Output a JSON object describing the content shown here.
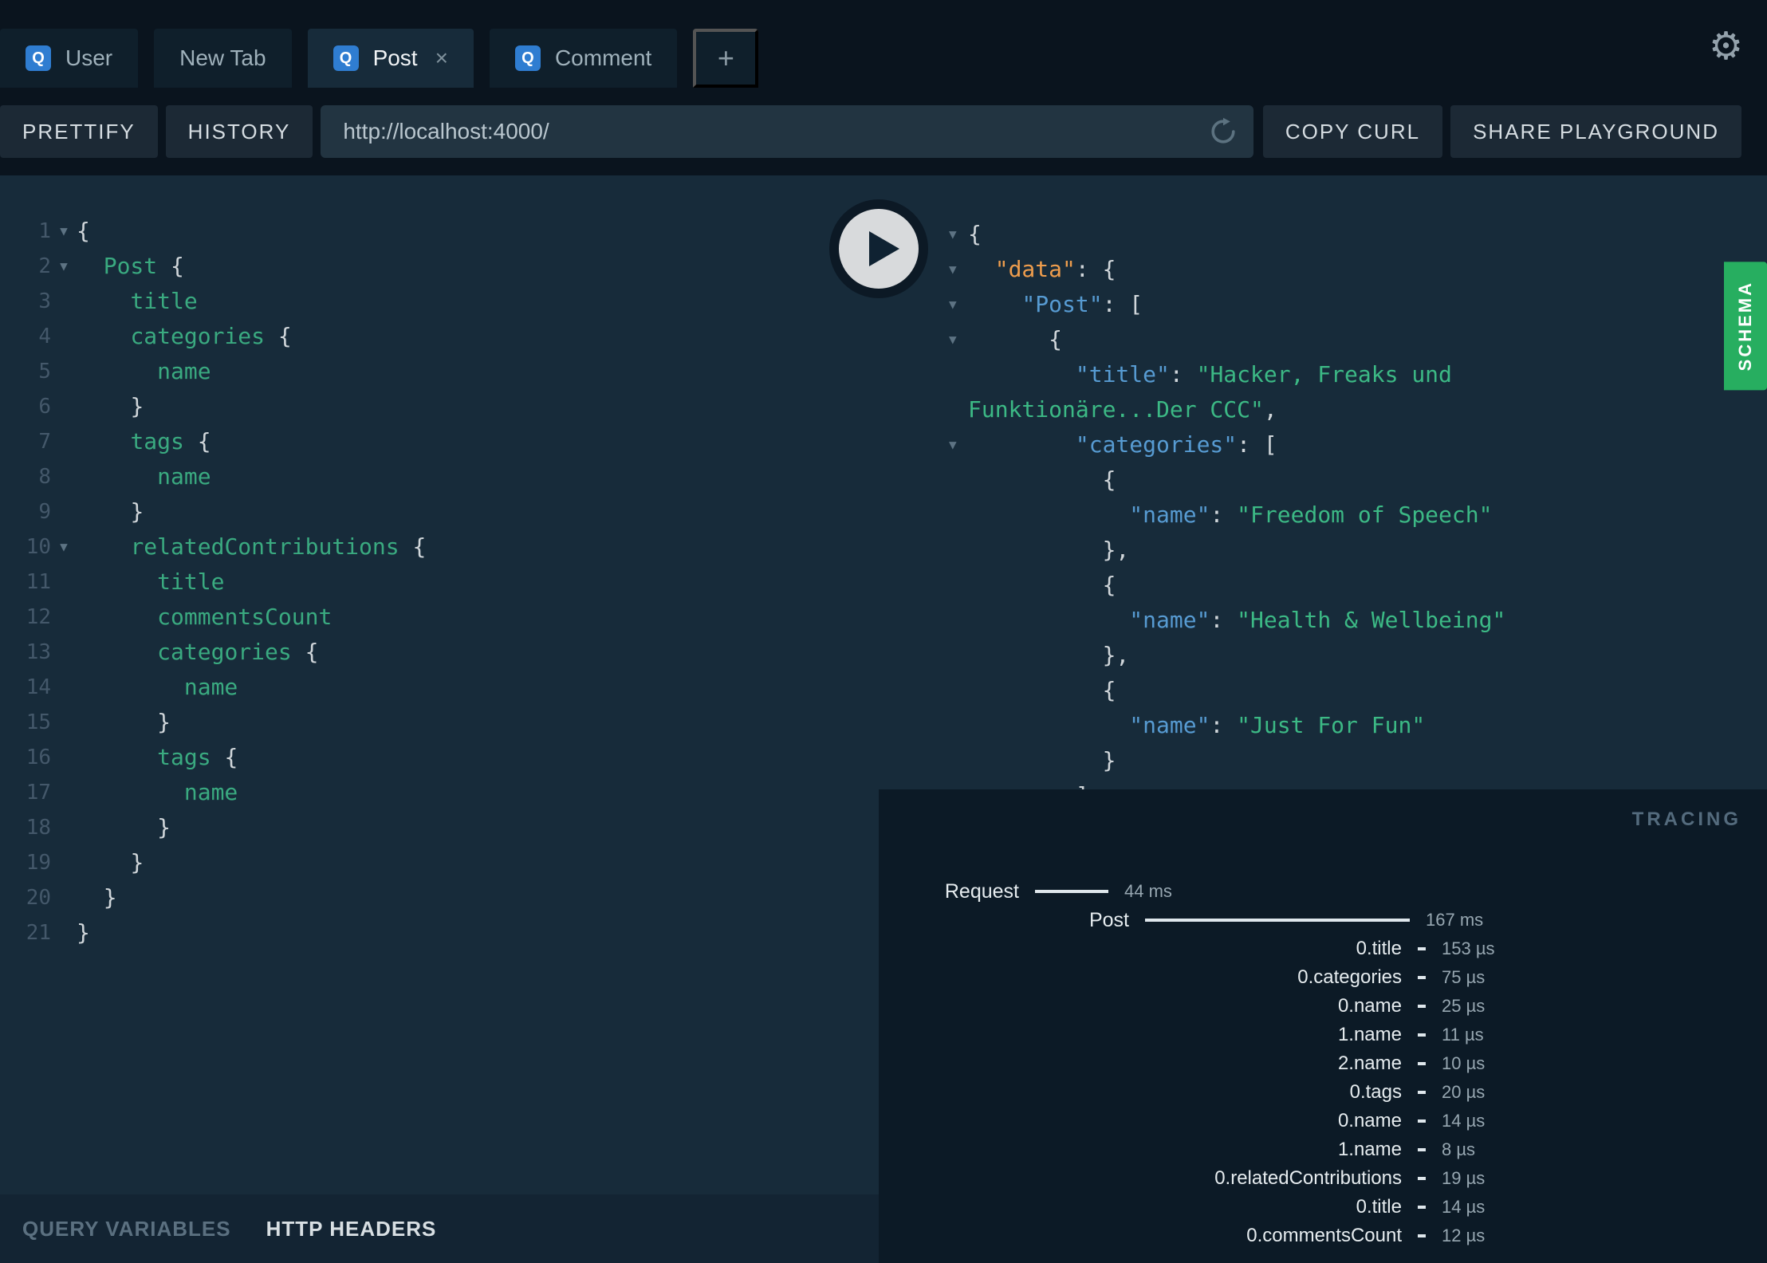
{
  "colors": {
    "schema_green": "#27ae60",
    "badge_blue": "#2f7dd1",
    "field_green": "#3aaa80",
    "key_blue": "#579bd2",
    "data_orange": "#ee9d4d",
    "string_green": "#3cb985"
  },
  "icons": {
    "settings": "⚙",
    "close": "×",
    "add": "+",
    "fold": "▼",
    "play": "play-triangle",
    "reload": "circular-arrow"
  },
  "tab_bar": {
    "tabs": [
      {
        "label": "User",
        "badge": "Q",
        "active": false,
        "closable": false
      },
      {
        "label": "New Tab",
        "badge": "",
        "active": false,
        "closable": false
      },
      {
        "label": "Post",
        "badge": "Q",
        "active": true,
        "closable": true
      },
      {
        "label": "Comment",
        "badge": "Q",
        "active": false,
        "closable": false
      }
    ]
  },
  "toolbar": {
    "prettify": "PRETTIFY",
    "history": "HISTORY",
    "url": "http://localhost:4000/",
    "copy_curl": "COPY CURL",
    "share": "SHARE PLAYGROUND"
  },
  "query_editor": {
    "lines": [
      {
        "n": 1,
        "indent": 0,
        "fold": true,
        "tokens": [
          [
            "{",
            "p"
          ]
        ]
      },
      {
        "n": 2,
        "indent": 1,
        "fold": true,
        "tokens": [
          [
            "Post ",
            "f"
          ],
          [
            "{",
            "p"
          ]
        ]
      },
      {
        "n": 3,
        "indent": 2,
        "fold": false,
        "tokens": [
          [
            "title",
            "f"
          ]
        ]
      },
      {
        "n": 4,
        "indent": 2,
        "fold": false,
        "tokens": [
          [
            "categories ",
            "f"
          ],
          [
            "{",
            "p"
          ]
        ]
      },
      {
        "n": 5,
        "indent": 3,
        "fold": false,
        "tokens": [
          [
            "name",
            "f"
          ]
        ]
      },
      {
        "n": 6,
        "indent": 2,
        "fold": false,
        "tokens": [
          [
            "}",
            "p"
          ]
        ]
      },
      {
        "n": 7,
        "indent": 2,
        "fold": false,
        "tokens": [
          [
            "tags ",
            "f"
          ],
          [
            "{",
            "p"
          ]
        ]
      },
      {
        "n": 8,
        "indent": 3,
        "fold": false,
        "tokens": [
          [
            "name",
            "f"
          ]
        ]
      },
      {
        "n": 9,
        "indent": 2,
        "fold": false,
        "tokens": [
          [
            "}",
            "p"
          ]
        ]
      },
      {
        "n": 10,
        "indent": 2,
        "fold": true,
        "tokens": [
          [
            "relatedContributions ",
            "f"
          ],
          [
            "{",
            "p"
          ]
        ]
      },
      {
        "n": 11,
        "indent": 3,
        "fold": false,
        "tokens": [
          [
            "title",
            "f"
          ]
        ]
      },
      {
        "n": 12,
        "indent": 3,
        "fold": false,
        "tokens": [
          [
            "commentsCount",
            "f"
          ]
        ]
      },
      {
        "n": 13,
        "indent": 3,
        "fold": false,
        "tokens": [
          [
            "categories ",
            "f"
          ],
          [
            "{",
            "p"
          ]
        ]
      },
      {
        "n": 14,
        "indent": 4,
        "fold": false,
        "tokens": [
          [
            "name",
            "f"
          ]
        ]
      },
      {
        "n": 15,
        "indent": 3,
        "fold": false,
        "tokens": [
          [
            "}",
            "p"
          ]
        ]
      },
      {
        "n": 16,
        "indent": 3,
        "fold": false,
        "tokens": [
          [
            "tags ",
            "f"
          ],
          [
            "{",
            "p"
          ]
        ]
      },
      {
        "n": 17,
        "indent": 4,
        "fold": false,
        "tokens": [
          [
            "name",
            "f"
          ]
        ]
      },
      {
        "n": 18,
        "indent": 3,
        "fold": false,
        "tokens": [
          [
            "}",
            "p"
          ]
        ]
      },
      {
        "n": 19,
        "indent": 2,
        "fold": false,
        "tokens": [
          [
            "}",
            "p"
          ]
        ]
      },
      {
        "n": 20,
        "indent": 1,
        "fold": false,
        "tokens": [
          [
            "}",
            "p"
          ]
        ]
      },
      {
        "n": 21,
        "indent": 0,
        "fold": false,
        "tokens": [
          [
            "}",
            "p"
          ]
        ]
      }
    ]
  },
  "response": {
    "lines": [
      {
        "indent": 0,
        "fold": true,
        "tokens": [
          [
            "{",
            "p"
          ]
        ]
      },
      {
        "indent": 1,
        "fold": true,
        "tokens": [
          [
            "\"data\"",
            "d"
          ],
          [
            ": {",
            "p"
          ]
        ]
      },
      {
        "indent": 2,
        "fold": true,
        "tokens": [
          [
            "\"Post\"",
            "k"
          ],
          [
            ": [",
            "p"
          ]
        ]
      },
      {
        "indent": 3,
        "fold": true,
        "tokens": [
          [
            "{",
            "p"
          ]
        ]
      },
      {
        "indent": 4,
        "fold": false,
        "tokens": [
          [
            "\"title\"",
            "k"
          ],
          [
            ": ",
            "p"
          ],
          [
            "\"Hacker, Freaks und",
            "s"
          ]
        ]
      },
      {
        "indent": 0,
        "fold": false,
        "tokens": [
          [
            "Funktionäre...Der CCC\"",
            "s"
          ],
          [
            ",",
            "p"
          ]
        ]
      },
      {
        "indent": 4,
        "fold": true,
        "tokens": [
          [
            "\"categories\"",
            "k"
          ],
          [
            ": [",
            "p"
          ]
        ]
      },
      {
        "indent": 5,
        "fold": false,
        "tokens": [
          [
            "{",
            "p"
          ]
        ]
      },
      {
        "indent": 6,
        "fold": false,
        "tokens": [
          [
            "\"name\"",
            "k"
          ],
          [
            ": ",
            "p"
          ],
          [
            "\"Freedom of Speech\"",
            "s"
          ]
        ]
      },
      {
        "indent": 5,
        "fold": false,
        "tokens": [
          [
            "},",
            "p"
          ]
        ]
      },
      {
        "indent": 5,
        "fold": false,
        "tokens": [
          [
            "{",
            "p"
          ]
        ]
      },
      {
        "indent": 6,
        "fold": false,
        "tokens": [
          [
            "\"name\"",
            "k"
          ],
          [
            ": ",
            "p"
          ],
          [
            "\"Health & Wellbeing\"",
            "s"
          ]
        ]
      },
      {
        "indent": 5,
        "fold": false,
        "tokens": [
          [
            "},",
            "p"
          ]
        ]
      },
      {
        "indent": 5,
        "fold": false,
        "tokens": [
          [
            "{",
            "p"
          ]
        ]
      },
      {
        "indent": 6,
        "fold": false,
        "tokens": [
          [
            "\"name\"",
            "k"
          ],
          [
            ": ",
            "p"
          ],
          [
            "\"Just For Fun\"",
            "s"
          ]
        ]
      },
      {
        "indent": 5,
        "fold": false,
        "tokens": [
          [
            "}",
            "p"
          ]
        ]
      },
      {
        "indent": 4,
        "fold": false,
        "tokens": [
          [
            "]",
            "p"
          ]
        ]
      }
    ]
  },
  "schema_tab": {
    "label": "SCHEMA"
  },
  "tracing": {
    "title": "TRACING",
    "rows": [
      {
        "label": "Request",
        "time": "44 ms",
        "kind": "root",
        "bar_start": 98,
        "bar_len": 46
      },
      {
        "label": "Post",
        "time": "167 ms",
        "kind": "root",
        "bar_start": 167,
        "bar_len": 166
      },
      {
        "label": "0.title",
        "time": "153 µs",
        "kind": "field",
        "bar_start": 338,
        "bar_len": 5
      },
      {
        "label": "0.categories",
        "time": "75 µs",
        "kind": "field",
        "bar_start": 338,
        "bar_len": 5
      },
      {
        "label": "0.name",
        "time": "25 µs",
        "kind": "field",
        "bar_start": 338,
        "bar_len": 5
      },
      {
        "label": "1.name",
        "time": "11 µs",
        "kind": "field",
        "bar_start": 338,
        "bar_len": 5
      },
      {
        "label": "2.name",
        "time": "10 µs",
        "kind": "field",
        "bar_start": 338,
        "bar_len": 5
      },
      {
        "label": "0.tags",
        "time": "20 µs",
        "kind": "field",
        "bar_start": 338,
        "bar_len": 5
      },
      {
        "label": "0.name",
        "time": "14 µs",
        "kind": "field",
        "bar_start": 338,
        "bar_len": 5
      },
      {
        "label": "1.name",
        "time": "8 µs",
        "kind": "field",
        "bar_start": 338,
        "bar_len": 5
      },
      {
        "label": "0.relatedContributions",
        "time": "19 µs",
        "kind": "field",
        "bar_start": 338,
        "bar_len": 5
      },
      {
        "label": "0.title",
        "time": "14 µs",
        "kind": "field",
        "bar_start": 338,
        "bar_len": 5
      },
      {
        "label": "0.commentsCount",
        "time": "12 µs",
        "kind": "field",
        "bar_start": 338,
        "bar_len": 5
      }
    ]
  },
  "bottom_bar": {
    "query_variables": "QUERY VARIABLES",
    "http_headers": "HTTP HEADERS"
  }
}
